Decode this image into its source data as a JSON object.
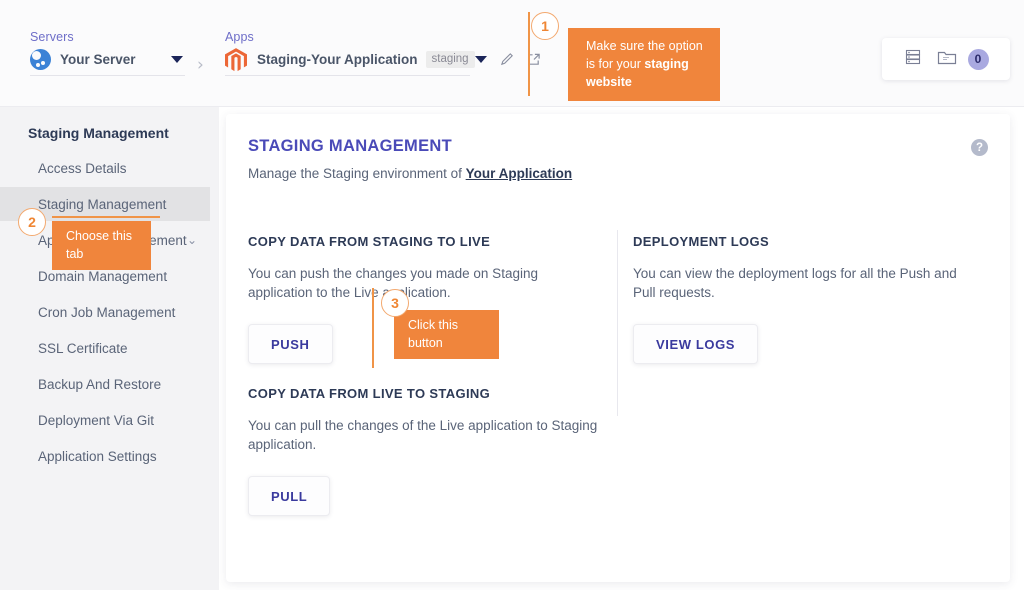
{
  "topbar": {
    "servers": {
      "label": "Servers",
      "name": "Your Server",
      "icon": "cloudways-logo-icon",
      "caret": "chevron-down-icon"
    },
    "breadcrumb_separator": "›",
    "apps": {
      "label": "Apps",
      "name": "Staging-Your Application",
      "badge": "staging",
      "icon": "magento-logo-icon",
      "caret": "chevron-down-icon",
      "edit_icon": "pencil-icon",
      "open_icon": "external-link-icon"
    },
    "widget": {
      "server_icon": "server-stack-icon",
      "folder_icon": "folder-icon",
      "count": "0"
    }
  },
  "sidebar": {
    "title": "Staging Management",
    "items": [
      {
        "label": "Access Details",
        "active": false
      },
      {
        "label": "Staging Management",
        "active": true
      },
      {
        "label": "Application Management",
        "active": false,
        "chevron": "⌄"
      },
      {
        "label": "Domain Management",
        "active": false
      },
      {
        "label": "Cron Job Management",
        "active": false
      },
      {
        "label": "SSL Certificate",
        "active": false
      },
      {
        "label": "Backup And Restore",
        "active": false
      },
      {
        "label": "Deployment Via Git",
        "active": false
      },
      {
        "label": "Application Settings",
        "active": false
      }
    ]
  },
  "card": {
    "title": "STAGING MANAGEMENT",
    "subtitle_prefix": "Manage the Staging environment of ",
    "subtitle_link": "Your Application",
    "help_icon": "question-mark-icon",
    "help_glyph": "?",
    "sections": {
      "push": {
        "heading": "COPY DATA FROM STAGING TO LIVE",
        "body": "You can push the changes you made on Staging application to the Live application.",
        "button": "PUSH"
      },
      "pull": {
        "heading": "COPY DATA FROM LIVE TO STAGING",
        "body": "You can pull the changes of the Live application to Staging application.",
        "button": "PULL"
      },
      "logs": {
        "heading": "DEPLOYMENT LOGS",
        "body": "You can view the deployment logs for all the Push and Pull requests.",
        "button": "VIEW LOGS"
      }
    }
  },
  "callouts": [
    {
      "number": "1",
      "text_prefix": "Make sure the option is for your ",
      "text_bold": "staging website"
    },
    {
      "number": "2",
      "text": "Choose this tab"
    },
    {
      "number": "3",
      "text": "Click this button"
    }
  ],
  "colors": {
    "accent_orange": "#f0853c",
    "accent_orange_line": "#f09447",
    "brand_purple": "#4a4ab8",
    "text_dark": "#2d3a56",
    "text_muted": "#5a6478",
    "sidebar_bg": "#f3f3f5",
    "badge_purple": "#a9a9e0"
  }
}
